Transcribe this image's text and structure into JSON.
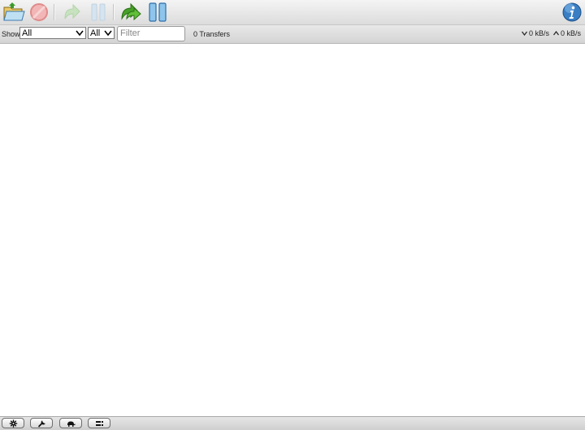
{
  "toolbar": {
    "buttons": [
      {
        "icon": "open-folder-icon",
        "enabled": true
      },
      {
        "icon": "remove-icon",
        "enabled": false
      },
      {
        "icon": "resume-icon",
        "enabled": false
      },
      {
        "icon": "pause-icon",
        "enabled": false
      },
      {
        "icon": "resume-all-icon",
        "enabled": true
      },
      {
        "icon": "pause-all-icon",
        "enabled": true
      },
      {
        "icon": "info-icon",
        "enabled": true
      }
    ]
  },
  "filterbar": {
    "show_label": "Show",
    "status_filter": "All",
    "tracker_filter": "All",
    "search_placeholder": "Filter",
    "transfer_count": "0 Transfers",
    "download_rate": "0 kB/s",
    "upload_rate": "0 kB/s"
  },
  "footer": {
    "buttons": [
      "settings-gear-icon",
      "preferences-wrench-icon",
      "turtle-speed-icon",
      "compact-view-icon"
    ]
  },
  "colors": {
    "toolbar_bg": "#dcdcdc",
    "accent_blue": "#3a7fc4",
    "accent_green": "#46a028"
  }
}
